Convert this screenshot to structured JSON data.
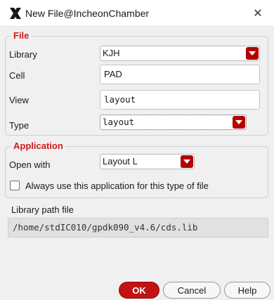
{
  "window": {
    "title": "New File@IncheonChamber",
    "close_glyph": "✕"
  },
  "file_group": {
    "legend": "File",
    "library_label": "Library",
    "library_value": "KJH",
    "cell_label": "Cell",
    "cell_value": "PAD",
    "view_label": "View",
    "view_value": "layout",
    "type_label": "Type",
    "type_value": "layout"
  },
  "application_group": {
    "legend": "Application",
    "open_with_label": "Open with",
    "open_with_value": "Layout L",
    "always_use_label": "Always use this application for this type of file",
    "always_use_checked": false
  },
  "library_path": {
    "label": "Library path file",
    "value": "/home/stdIC010/gpdk090_v4.6/cds.lib"
  },
  "buttons": {
    "ok": "OK",
    "cancel": "Cancel",
    "help": "Help"
  },
  "colors": {
    "accent": "#c41212",
    "dropdown_arrow": "#b40000",
    "legend_text": "#d11a1a"
  },
  "icons": {
    "app": "cadence-x-icon",
    "close": "close-icon",
    "dropdown": "chevron-down-icon"
  }
}
